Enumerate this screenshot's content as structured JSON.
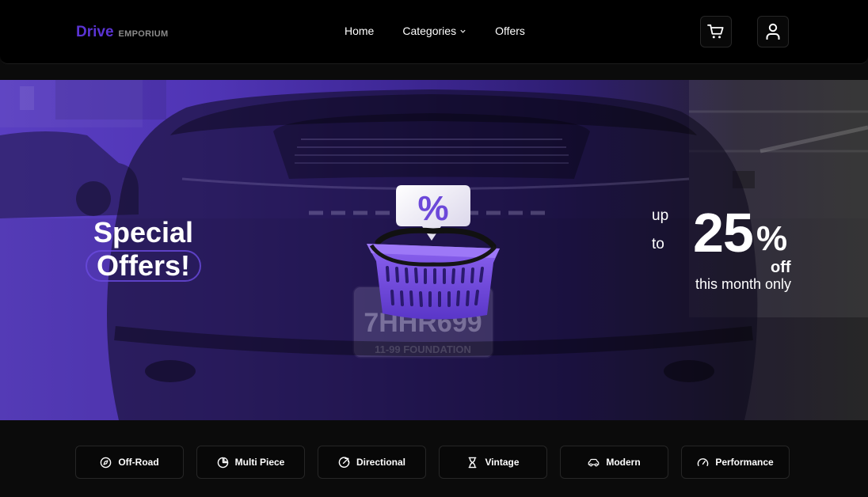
{
  "brand": {
    "name": "Drive",
    "sub": "EMPORIUM",
    "color": "#5b34d4"
  },
  "nav": {
    "home": "Home",
    "categories": "Categories",
    "offers": "Offers"
  },
  "header_icons": {
    "cart": "cart-icon",
    "user": "user-icon"
  },
  "hero": {
    "title_line1": "Special",
    "title_line2": "Offers!",
    "up": "up",
    "to": "to",
    "discount_number": "25",
    "percent_sign": "%",
    "off": "off",
    "period": "this month only",
    "accent": "#5a3fc2",
    "graphic": "shopping-basket-percent"
  },
  "categories": [
    {
      "label": "Off-Road",
      "icon": "compass-icon"
    },
    {
      "label": "Multi Piece",
      "icon": "pie-chart-icon"
    },
    {
      "label": "Directional",
      "icon": "arrow-up-right-circle-icon"
    },
    {
      "label": "Vintage",
      "icon": "hourglass-icon"
    },
    {
      "label": "Modern",
      "icon": "car-icon"
    },
    {
      "label": "Performance",
      "icon": "gauge-icon"
    }
  ]
}
